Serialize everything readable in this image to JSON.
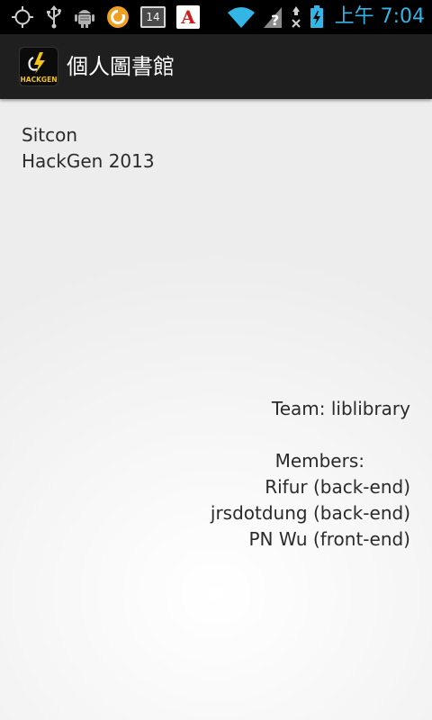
{
  "status_bar": {
    "icons_left": [
      "gps-icon",
      "usb-icon",
      "android-debug-icon",
      "sync-app-icon",
      "calendar-icon",
      "adobe-reader-icon"
    ],
    "calendar_day": "14",
    "adobe_letter": "A",
    "icons_right": [
      "wifi-icon",
      "no-signal-icon",
      "data-off-icon",
      "battery-charging-icon"
    ],
    "time": "上午 7:04",
    "accent_color": "#33b5e5"
  },
  "action_bar": {
    "title": "個人圖書館",
    "logo_text": "HACKGEN",
    "background": "#1f1f1f"
  },
  "main": {
    "event_lines": [
      "Sitcon",
      "HackGen 2013"
    ],
    "team": "Team: liblibrary",
    "members_heading": "Members:",
    "members": [
      "Rifur (back-end)",
      "jrsdotdung (back-end)",
      "PN Wu (front-end)"
    ]
  }
}
